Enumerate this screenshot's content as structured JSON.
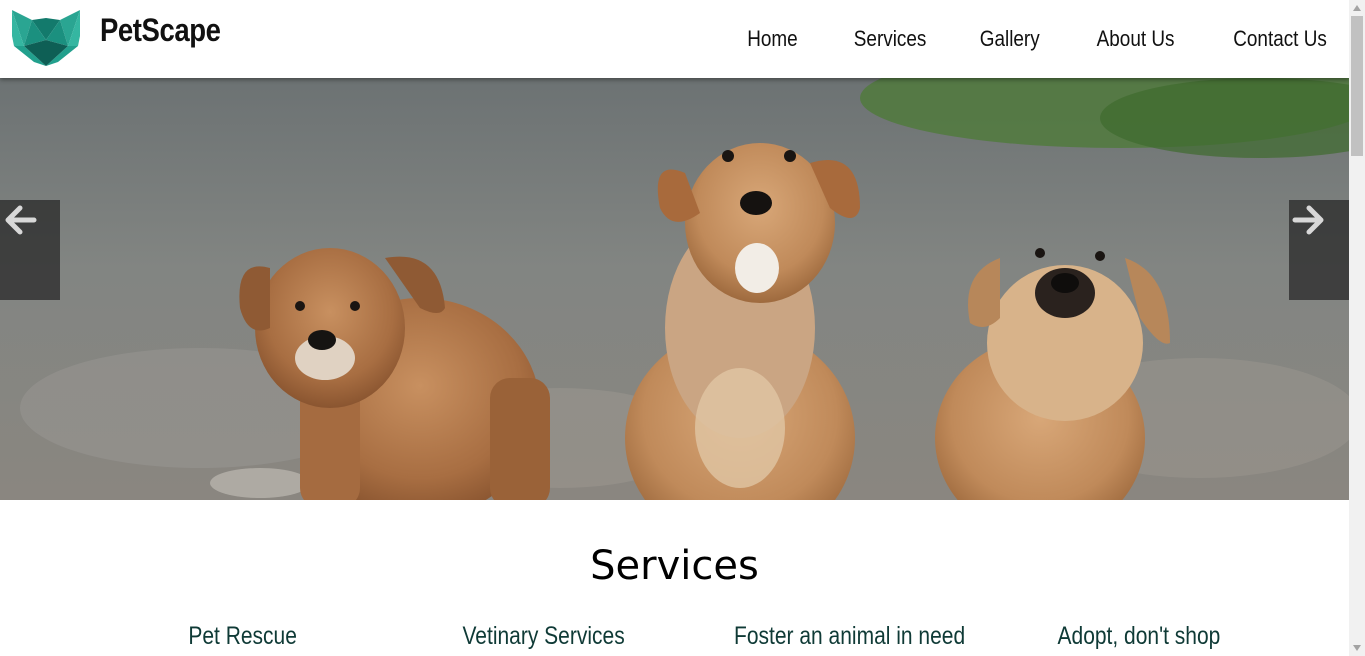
{
  "header": {
    "brand": "PetScape",
    "logo_icon": "geometric-fox-logo",
    "nav": [
      {
        "label": "Home"
      },
      {
        "label": "Services"
      },
      {
        "label": "Gallery"
      },
      {
        "label": "About Us"
      },
      {
        "label": "Contact Us"
      }
    ]
  },
  "hero": {
    "image": "three-puppies-photo",
    "prev_icon": "arrow-left-icon",
    "next_icon": "arrow-right-icon"
  },
  "services": {
    "title": "Services",
    "items": [
      {
        "label": "Pet Rescue"
      },
      {
        "label": "Vetinary Services"
      },
      {
        "label": "Foster an animal in need"
      },
      {
        "label": "Adopt, don't shop"
      }
    ]
  },
  "colors": {
    "logo_teal": "#1a8a7c",
    "service_heading": "#0f3a36"
  }
}
